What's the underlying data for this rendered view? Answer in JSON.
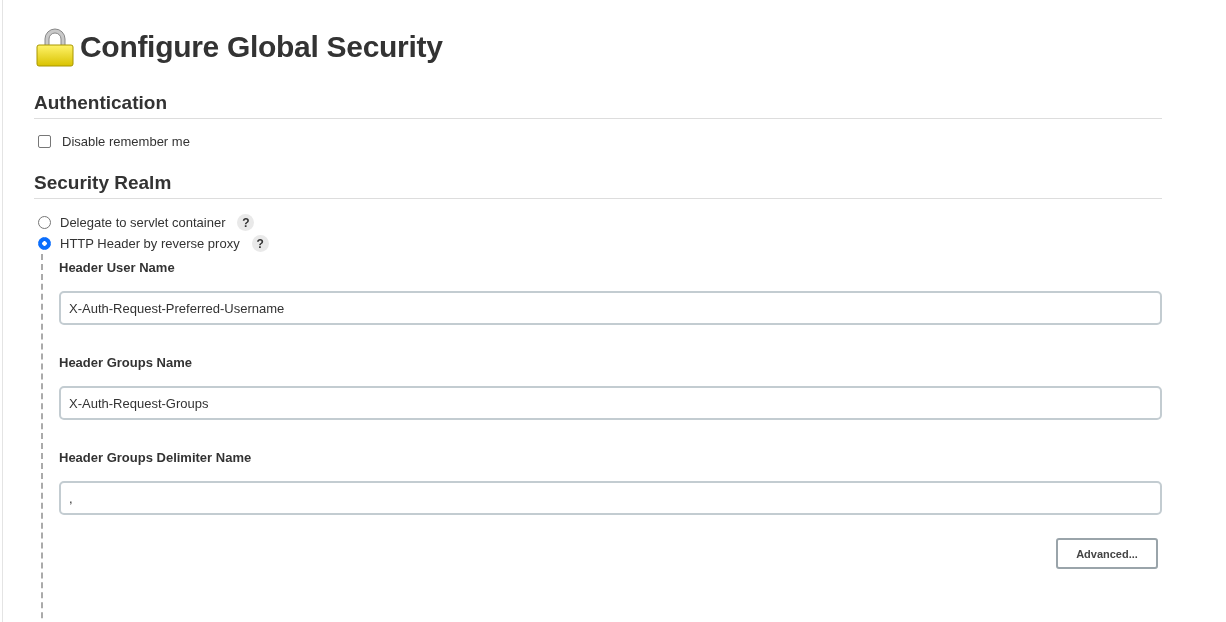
{
  "title": "Configure Global Security",
  "sections": [
    {
      "heading": "Authentication",
      "options": [
        {
          "kind": "checkbox",
          "label": "Disable remember me",
          "checked": false
        }
      ]
    },
    {
      "heading": "Security Realm",
      "options": [
        {
          "kind": "radio",
          "label": "Delegate to servlet container",
          "selected": false,
          "help": "?"
        },
        {
          "kind": "radio",
          "label": "HTTP Header by reverse proxy",
          "selected": true,
          "help": "?",
          "fields": [
            {
              "label": "Header User Name",
              "value": "X-Auth-Request-Preferred-Username"
            },
            {
              "label": "Header Groups Name",
              "value": "X-Auth-Request-Groups"
            },
            {
              "label": "Header Groups Delimiter Name",
              "value": ","
            }
          ],
          "button": "Advanced..."
        }
      ]
    }
  ]
}
